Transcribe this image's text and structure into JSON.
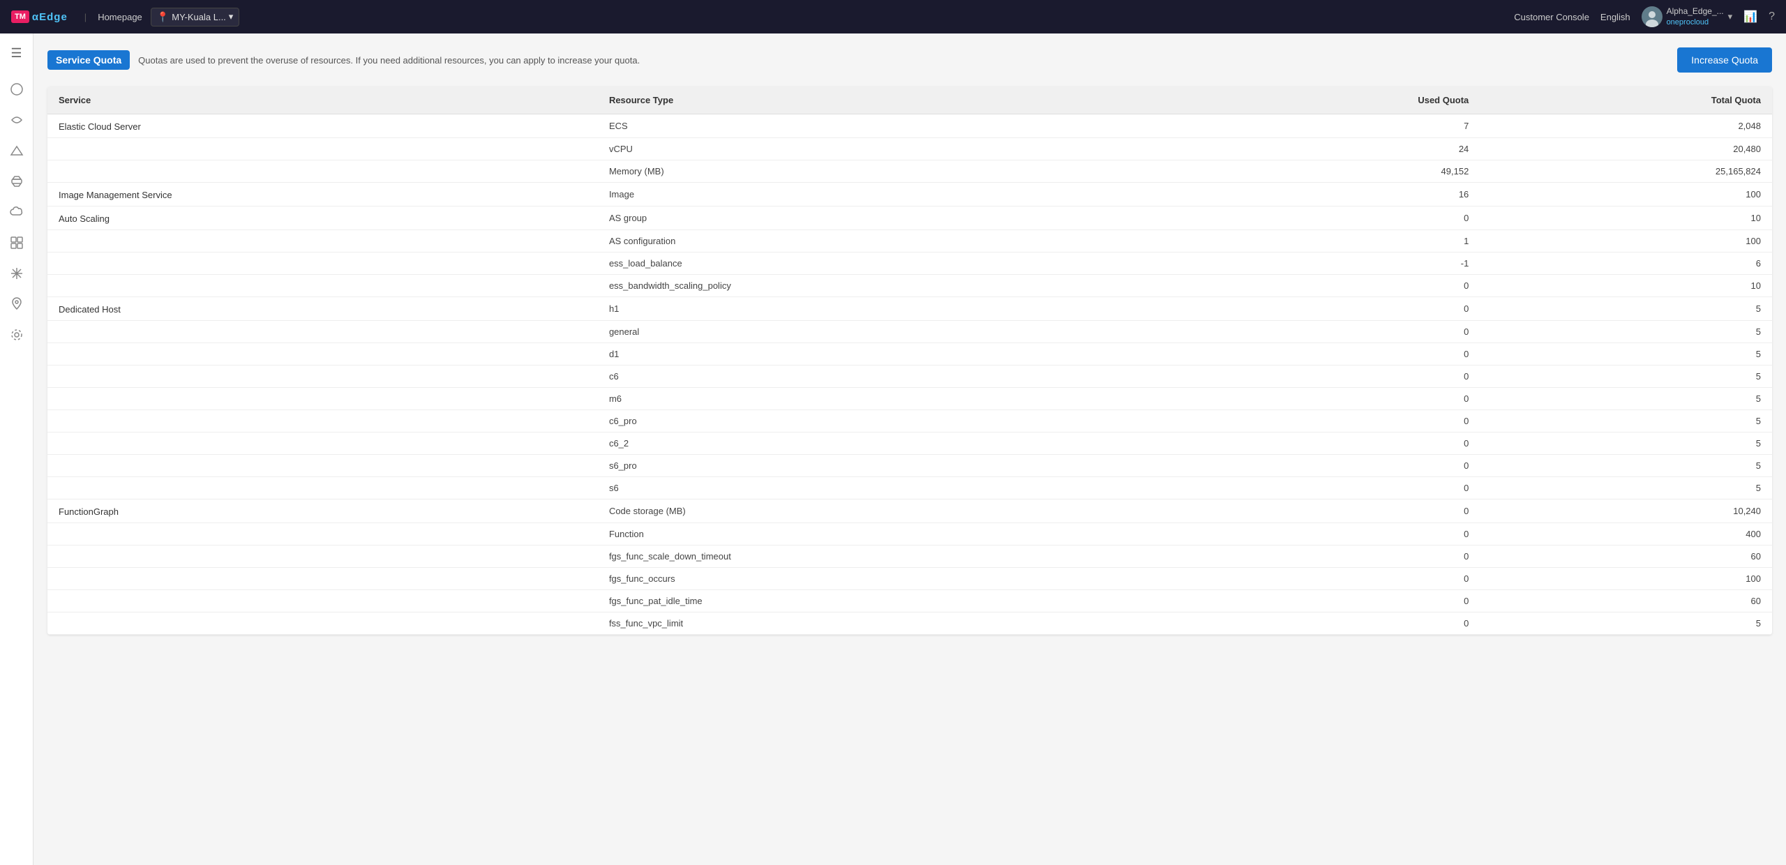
{
  "topnav": {
    "logo_text": "TM",
    "brand": "αEdge",
    "divider": "|",
    "homepage": "Homepage",
    "location": "MY-Kuala L...",
    "location_icon": "📍",
    "customer_console": "Customer Console",
    "language": "English",
    "username": "Alpha_Edge_...",
    "subname": "oneprocloud",
    "chevron": "▾",
    "bar_icon": "📊",
    "help_icon": "?"
  },
  "sidebar": {
    "hamburger": "☰",
    "items": [
      {
        "icon": "○",
        "name": "circle-icon"
      },
      {
        "icon": "☁",
        "name": "cloud-icon"
      },
      {
        "icon": "◇",
        "name": "diamond-icon"
      },
      {
        "icon": "⌂",
        "name": "mountain-icon"
      },
      {
        "icon": "☁",
        "name": "cloud2-icon"
      },
      {
        "icon": "▣",
        "name": "grid-icon"
      },
      {
        "icon": "☁",
        "name": "cloud3-icon"
      },
      {
        "icon": "⚓",
        "name": "anchor-icon"
      },
      {
        "icon": "◉",
        "name": "circle2-icon"
      }
    ]
  },
  "page": {
    "title": "Service Quota",
    "description": "Quotas are used to prevent the overuse of resources. If you need additional resources, you can apply to increase your quota.",
    "increase_quota_btn": "Increase Quota"
  },
  "table": {
    "columns": [
      "Service",
      "Resource Type",
      "Used Quota",
      "Total Quota"
    ],
    "rows": [
      {
        "service": "Elastic Cloud Server",
        "resource": "ECS",
        "used": "7",
        "total": "2,048"
      },
      {
        "service": "",
        "resource": "vCPU",
        "used": "24",
        "total": "20,480"
      },
      {
        "service": "",
        "resource": "Memory (MB)",
        "used": "49,152",
        "total": "25,165,824"
      },
      {
        "service": "Image Management Service",
        "resource": "Image",
        "used": "16",
        "total": "100"
      },
      {
        "service": "Auto Scaling",
        "resource": "AS group",
        "used": "0",
        "total": "10"
      },
      {
        "service": "",
        "resource": "AS configuration",
        "used": "1",
        "total": "100"
      },
      {
        "service": "",
        "resource": "ess_load_balance",
        "used": "-1",
        "total": "6"
      },
      {
        "service": "",
        "resource": "ess_bandwidth_scaling_policy",
        "used": "0",
        "total": "10"
      },
      {
        "service": "Dedicated Host",
        "resource": "h1",
        "used": "0",
        "total": "5"
      },
      {
        "service": "",
        "resource": "general",
        "used": "0",
        "total": "5"
      },
      {
        "service": "",
        "resource": "d1",
        "used": "0",
        "total": "5"
      },
      {
        "service": "",
        "resource": "c6",
        "used": "0",
        "total": "5"
      },
      {
        "service": "",
        "resource": "m6",
        "used": "0",
        "total": "5"
      },
      {
        "service": "",
        "resource": "c6_pro",
        "used": "0",
        "total": "5"
      },
      {
        "service": "",
        "resource": "c6_2",
        "used": "0",
        "total": "5"
      },
      {
        "service": "",
        "resource": "s6_pro",
        "used": "0",
        "total": "5"
      },
      {
        "service": "",
        "resource": "s6",
        "used": "0",
        "total": "5"
      },
      {
        "service": "FunctionGraph",
        "resource": "Code storage (MB)",
        "used": "0",
        "total": "10,240"
      },
      {
        "service": "",
        "resource": "Function",
        "used": "0",
        "total": "400"
      },
      {
        "service": "",
        "resource": "fgs_func_scale_down_timeout",
        "used": "0",
        "total": "60"
      },
      {
        "service": "",
        "resource": "fgs_func_occurs",
        "used": "0",
        "total": "100"
      },
      {
        "service": "",
        "resource": "fgs_func_pat_idle_time",
        "used": "0",
        "total": "60"
      },
      {
        "service": "",
        "resource": "fss_func_vpc_limit",
        "used": "0",
        "total": "5"
      }
    ]
  }
}
